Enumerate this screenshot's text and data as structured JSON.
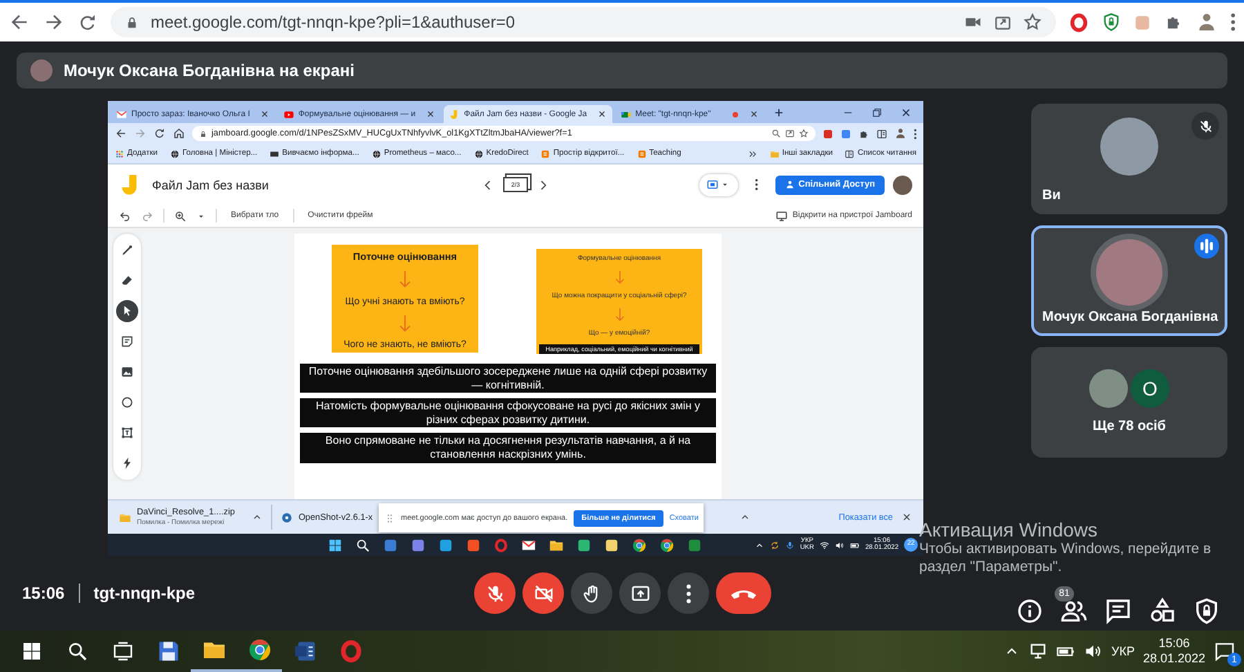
{
  "browser": {
    "url": "meet.google.com/tgt-nnqn-kpe?pli=1&authuser=0"
  },
  "presenter_banner": {
    "text": "Мочук Оксана Богданівна на екрані"
  },
  "shared_screen": {
    "tabs": [
      {
        "label": "Просто зараз: Іваночко Ольга І",
        "kind": "mail",
        "selected": false,
        "recording": false
      },
      {
        "label": "Формувальне оцінювання — и",
        "kind": "video",
        "selected": false,
        "recording": false
      },
      {
        "label": "Файл Jam без назви - Google Ja",
        "kind": "jam",
        "selected": true,
        "recording": false
      },
      {
        "label": "Meet: \"tgt-nnqn-kpe\"",
        "kind": "meet",
        "selected": false,
        "recording": true
      }
    ],
    "url": "jamboard.google.com/d/1NPesZSxMV_HUCgUxTNhfyvlvK_ol1KgXTtZltmJbaHA/viewer?f=1",
    "bookmarks": [
      {
        "label": "Додатки",
        "kind": "apps"
      },
      {
        "label": "Головна | Міністер...",
        "kind": "globe"
      },
      {
        "label": "Вивчаємо інформа...",
        "kind": "card"
      },
      {
        "label": "Prometheus – масо...",
        "kind": "globe"
      },
      {
        "label": "KredoDirect",
        "kind": "globe"
      },
      {
        "label": "Простір відкритої...",
        "kind": "blog"
      },
      {
        "label": "Teaching",
        "kind": "blog"
      }
    ],
    "other_bookmarks": "Інші закладки",
    "reading_list": "Список читання",
    "jam_title": "Файл Jam без назви",
    "frame_counter": "2/3",
    "share_button": "Спільний Доступ",
    "toolbar": [
      "Вибрати тло",
      "Очистити фрейм"
    ],
    "open_on_device": "Відкрити на пристрої Jamboard",
    "tools": [
      {
        "kind": "pen",
        "selected": false
      },
      {
        "kind": "eraser",
        "selected": false
      },
      {
        "kind": "select",
        "selected": true
      },
      {
        "kind": "note",
        "selected": false
      },
      {
        "kind": "image",
        "selected": false
      },
      {
        "kind": "circle",
        "selected": false
      },
      {
        "kind": "textbox",
        "selected": false
      },
      {
        "kind": "laser",
        "selected": false
      }
    ],
    "cards": [
      {
        "title": "Поточне оцінювання",
        "lines": [
          "Що учні знають та вміють?",
          "Чого не знають, не вміють?"
        ]
      },
      {
        "title": "Формувальне оцінювання",
        "lines": [
          "Що можна покращити у соціальній сфері?",
          "Що — у емоційній?"
        ],
        "caption": "Наприклад, соціальний, емоційний чи когнітивний"
      }
    ],
    "subtitles": [
      "Поточне оцінювання здебільшого зосереджене лише на одній сфері розвитку — когнітивній.",
      "Натомість формувальне оцінювання сфокусоване на русі до якісних змін у різних сферах розвитку дитини.",
      "Воно спрямоване не тільки на досягнення результатів навчання, а й на становлення наскрізних умінь."
    ],
    "downloads": [
      {
        "name": "DaVinci_Resolve_1....zip",
        "status": "Помилка - Помилка мережі"
      },
      {
        "name": "OpenShot-v2.6.1-x"
      }
    ],
    "show_all": "Показати все",
    "share_notice": {
      "text": "meet.google.com має доступ до вашого екрана.",
      "stop_button": "Більше не ділитися",
      "hide_link": "Сховати"
    },
    "taskbar": {
      "language": "УКР",
      "layout": "UKR",
      "time": "15:06",
      "date": "28.01.2022",
      "notification_count": "22"
    }
  },
  "participants": [
    {
      "kind": "person",
      "name": "Ви",
      "muted": true,
      "speaking": false
    },
    {
      "kind": "person",
      "name": "Мочук Оксана Богданівна",
      "muted": false,
      "speaking": true
    },
    {
      "kind": "others",
      "name": "Ще 78 осіб",
      "initial": "О"
    }
  ],
  "meeting": {
    "time": "15:06",
    "code": "tgt-nnqn-kpe"
  },
  "controls": [
    {
      "kind": "mic",
      "off": true
    },
    {
      "kind": "camera",
      "off": true
    },
    {
      "kind": "hand"
    },
    {
      "kind": "present"
    },
    {
      "kind": "more"
    },
    {
      "kind": "hangup"
    }
  ],
  "side_controls": [
    {
      "kind": "info"
    },
    {
      "kind": "people",
      "badge": "81"
    },
    {
      "kind": "chat"
    },
    {
      "kind": "activities"
    },
    {
      "kind": "safety"
    }
  ],
  "activation": {
    "title": "Активация Windows",
    "lines": [
      "Чтобы активировать Windows, перейдите в",
      "раздел \"Параметры\"."
    ]
  },
  "taskbar": {
    "apps": [
      {
        "kind": "save",
        "running": false
      },
      {
        "kind": "folder",
        "running": true
      },
      {
        "kind": "chrome",
        "running": true
      },
      {
        "kind": "word",
        "running": false
      },
      {
        "kind": "opera",
        "running": false
      }
    ],
    "language": "УКР",
    "time": "15:06",
    "date": "28.01.2022",
    "notification_count": "1"
  }
}
